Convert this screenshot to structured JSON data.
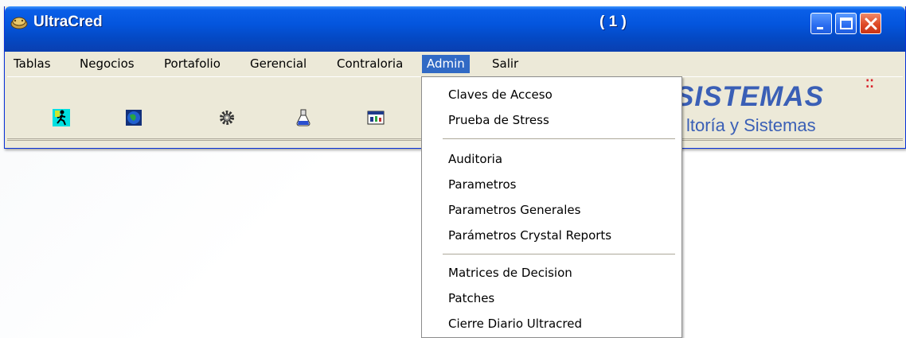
{
  "window": {
    "title": "UltraCred",
    "count": "( 1 )"
  },
  "titlebar_buttons": [
    "minimize",
    "maximize",
    "close"
  ],
  "menu": [
    {
      "label": "Tablas"
    },
    {
      "label": "Negocios"
    },
    {
      "label": "Portafolio"
    },
    {
      "label": "Gerencial"
    },
    {
      "label": "Contraloria"
    },
    {
      "label": "Admin",
      "active": true
    },
    {
      "label": "Salir"
    }
  ],
  "toolbar": {
    "icons": [
      "run-icon",
      "globe-icon",
      "gear-icon",
      "flask-icon",
      "report-window-icon"
    ]
  },
  "logo": {
    "brand": "SISTEMAS",
    "tagline": "ltoría y Sistemas"
  },
  "admin_menu": {
    "group1": [
      "Claves de Acceso",
      "Prueba de Stress"
    ],
    "group2": [
      "Auditoria",
      "Parametros",
      "Parametros Generales",
      "Parámetros Crystal Reports"
    ],
    "group3": [
      "Matrices de Decision",
      "Patches",
      "Cierre Diario Ultracred"
    ]
  },
  "colors": {
    "titlebar": "#0455dd",
    "menu_highlight": "#316ac5",
    "logo": "#3a5fb6",
    "chrome": "#ece9d8"
  }
}
